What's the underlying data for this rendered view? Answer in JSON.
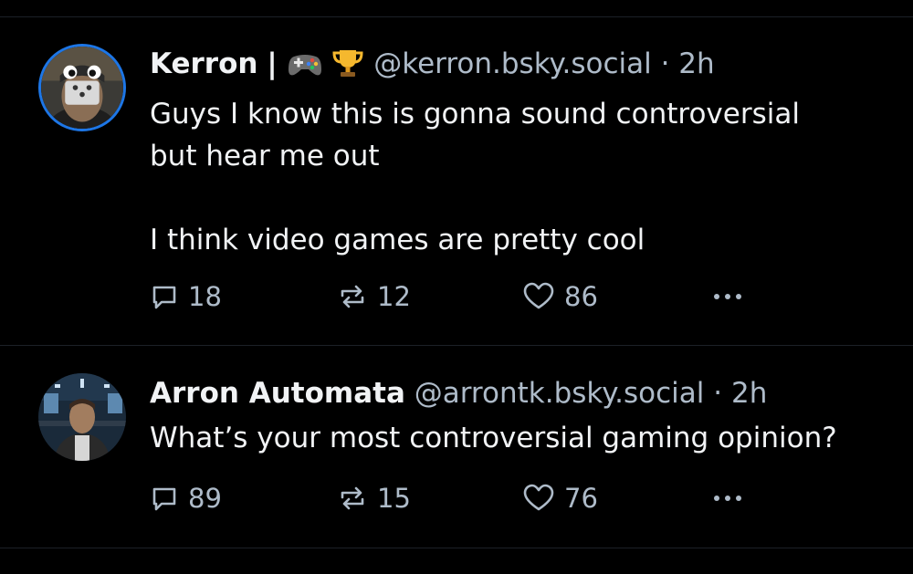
{
  "posts": [
    {
      "display_name": "Kerron",
      "name_separator": "|",
      "name_emojis": [
        "game-controller-icon",
        "trophy-icon"
      ],
      "handle": "@kerron.bsky.social",
      "separator": "·",
      "time": "2h",
      "text": "Guys I know this is gonna sound controversial\nbut hear me out\n\nI think video games are pretty cool",
      "replies": "18",
      "reposts": "12",
      "likes": "86"
    },
    {
      "display_name": "Arron Automata",
      "handle": "@arrontk.bsky.social",
      "separator": "·",
      "time": "2h",
      "text": "What’s your most controversial gaming opinion?",
      "replies": "89",
      "reposts": "15",
      "likes": "76"
    }
  ],
  "colors": {
    "background": "#000000",
    "text": "#f1f3f5",
    "muted": "#aebbc9",
    "divider": "#1c2027",
    "avatar_ring": "#1d76e6"
  }
}
